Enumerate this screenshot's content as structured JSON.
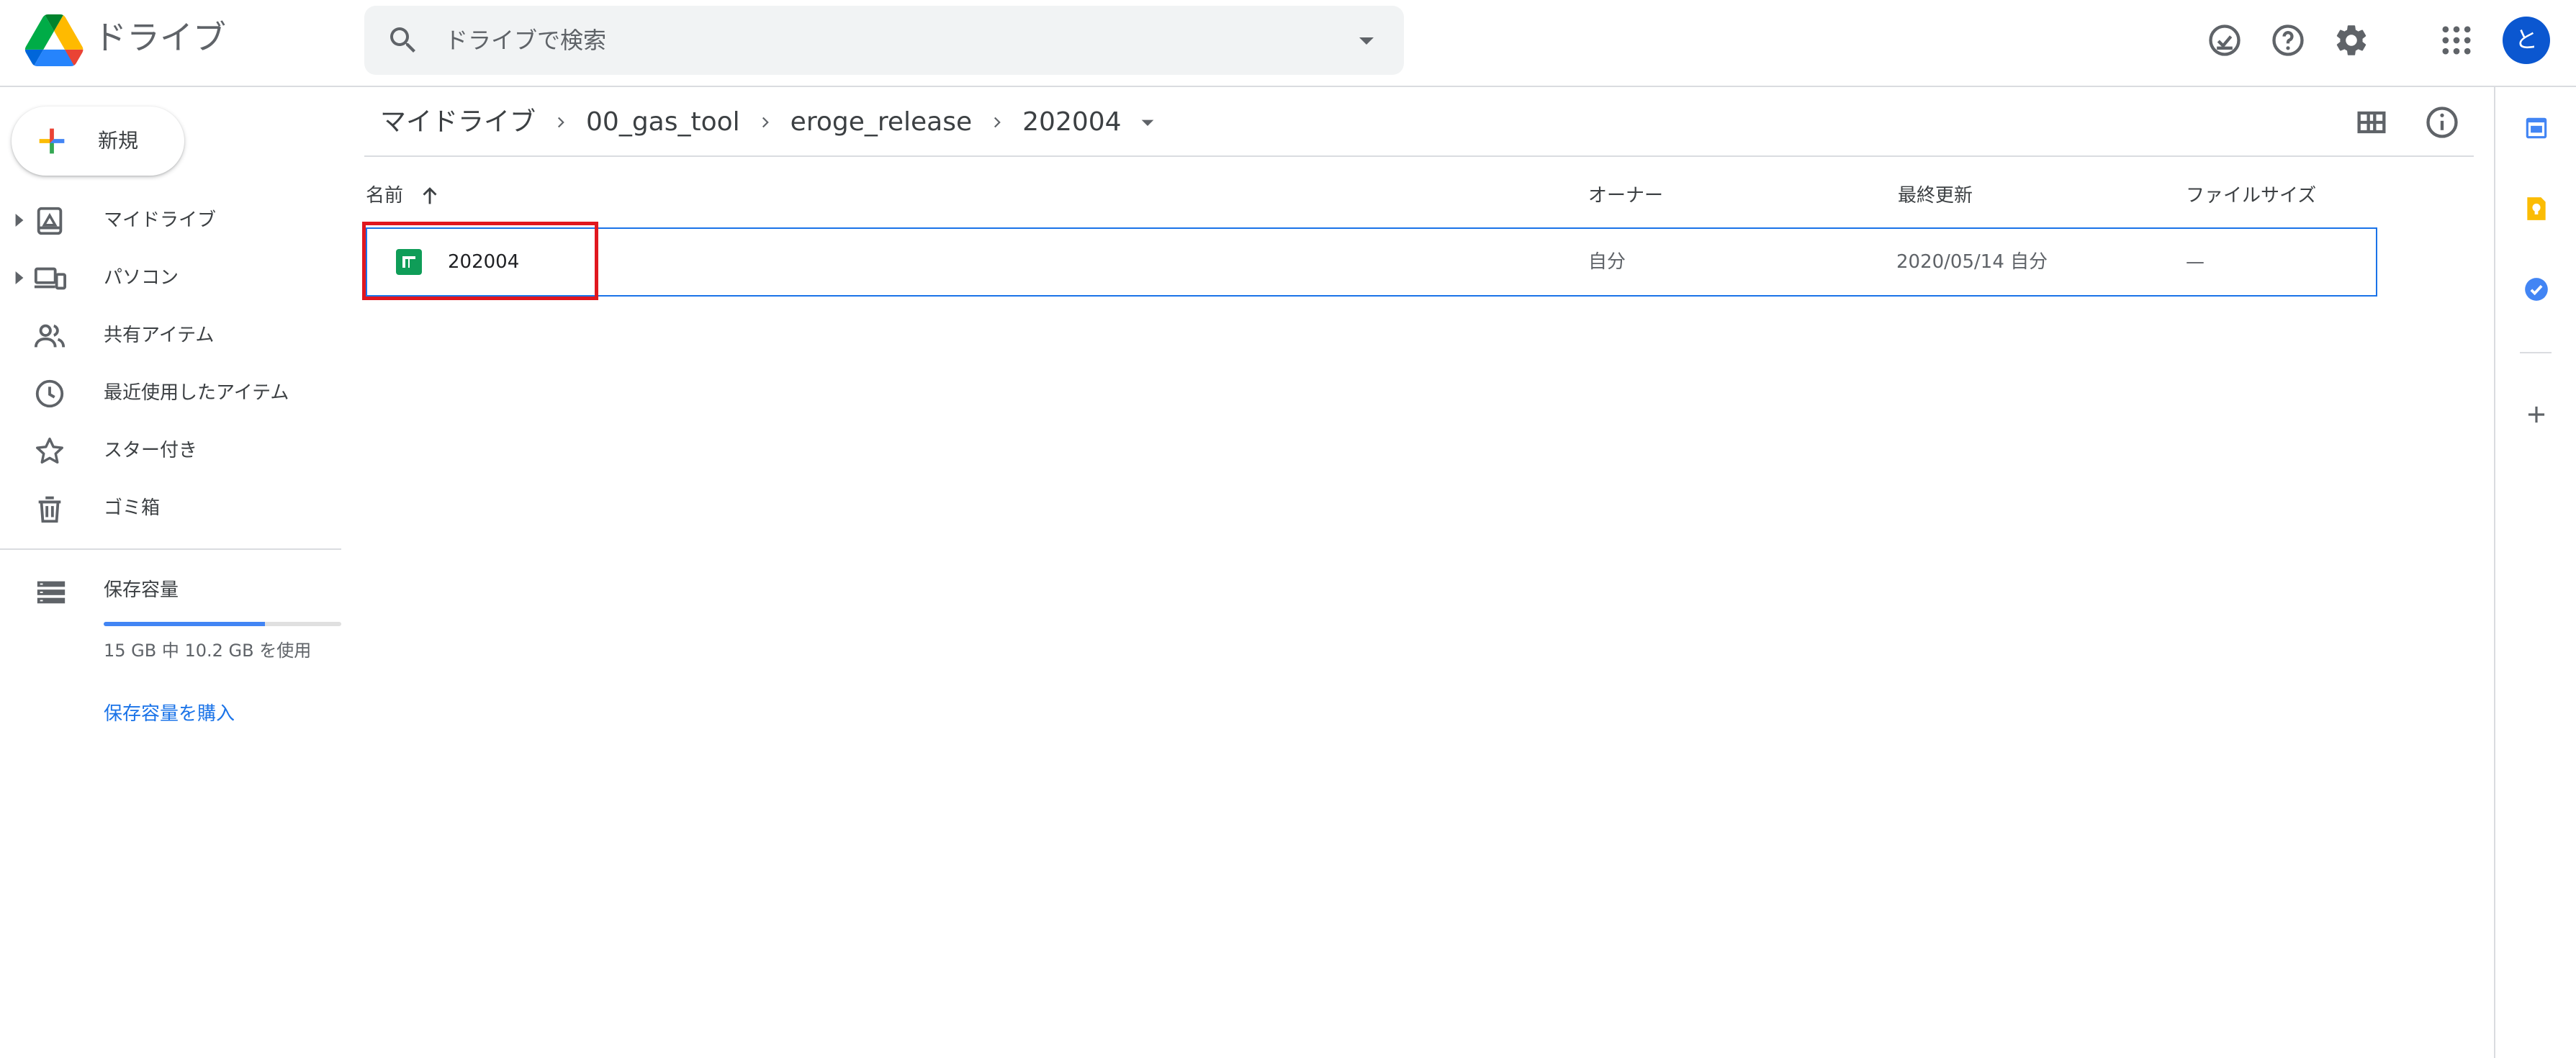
{
  "app": {
    "title": "ドライブ"
  },
  "search": {
    "placeholder": "ドライブで検索"
  },
  "header": {
    "avatar_initial": "と"
  },
  "sidebar": {
    "new_label": "新規",
    "items": [
      {
        "label": "マイドライブ",
        "icon": "my-drive-icon",
        "expandable": true
      },
      {
        "label": "パソコン",
        "icon": "computers-icon",
        "expandable": true
      },
      {
        "label": "共有アイテム",
        "icon": "shared-icon",
        "expandable": false
      },
      {
        "label": "最近使用したアイテム",
        "icon": "recent-icon",
        "expandable": false
      },
      {
        "label": "スター付き",
        "icon": "star-icon",
        "expandable": false
      },
      {
        "label": "ゴミ箱",
        "icon": "trash-icon",
        "expandable": false
      }
    ],
    "storage": {
      "label": "保存容量",
      "usage_text": "15 GB 中 10.2 GB を使用",
      "used_fraction": 0.68,
      "buy_label": "保存容量を購入"
    }
  },
  "breadcrumb": [
    "マイドライブ",
    "00_gas_tool",
    "eroge_release",
    "202004"
  ],
  "table": {
    "headers": {
      "name": "名前",
      "owner": "オーナー",
      "modified": "最終更新",
      "size": "ファイルサイズ"
    },
    "rows": [
      {
        "name": "202004",
        "owner": "自分",
        "modified": "2020/05/14 自分",
        "size": "—",
        "type": "google-sheets"
      }
    ]
  },
  "colors": {
    "accent": "#1a73e8",
    "sheets_green": "#0f9d58",
    "highlight": "#e0171f"
  }
}
